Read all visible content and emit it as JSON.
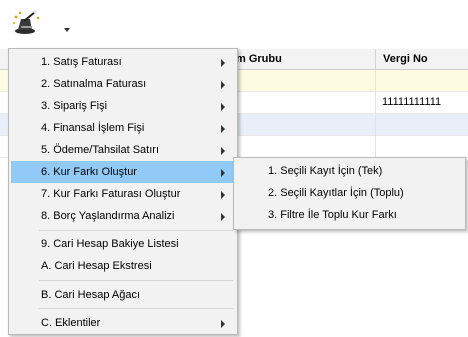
{
  "grid": {
    "columns": [
      "m Grubu",
      "Vergi No"
    ],
    "rows": [
      {
        "vergi_no": ""
      },
      {
        "vergi_no": "11111111111"
      },
      {
        "vergi_no": ""
      },
      {
        "vergi_no": ""
      }
    ],
    "row_colors": [
      "#fdfbe0",
      "#ffffff",
      "#e9eef8",
      "#ffffff"
    ]
  },
  "menu": {
    "items": [
      {
        "label": "1. Satış Faturası",
        "submenu": true
      },
      {
        "label": "2. Satınalma Faturası",
        "submenu": true
      },
      {
        "label": "3. Sipariş Fişi",
        "submenu": true
      },
      {
        "label": "4. Finansal İşlem Fişi",
        "submenu": true
      },
      {
        "label": "5. Ödeme/Tahsilat Satırı",
        "submenu": true
      },
      {
        "label": "6. Kur Farkı Oluştur",
        "submenu": true,
        "active": true
      },
      {
        "label": "7. Kur Farkı Faturası Oluştur",
        "submenu": true
      },
      {
        "label": "8. Borç Yaşlandırma Analizi",
        "submenu": true
      },
      {
        "label": "9. Cari Hesap Bakiye Listesi",
        "submenu": false
      },
      {
        "label": "A. Cari Hesap Ekstresi",
        "submenu": false
      },
      {
        "label": "B. Cari Hesap Ağacı",
        "submenu": false
      },
      {
        "label": "C. Eklentiler",
        "submenu": true
      }
    ]
  },
  "submenu": {
    "items": [
      {
        "label": "1. Seçili Kayıt İçin (Tek)"
      },
      {
        "label": "2. Seçili Kayıtlar İçin (Toplu)"
      },
      {
        "label": "3. Filtre İle Toplu Kur Farkı"
      }
    ]
  },
  "colors": {
    "menu_bg": "#f2f2f2",
    "highlight": "#91c9f7"
  },
  "icons": {
    "toolbar": "magic-wand-hat-icon",
    "dropdown": "chevron-down-icon",
    "submenu": "chevron-right-icon"
  }
}
